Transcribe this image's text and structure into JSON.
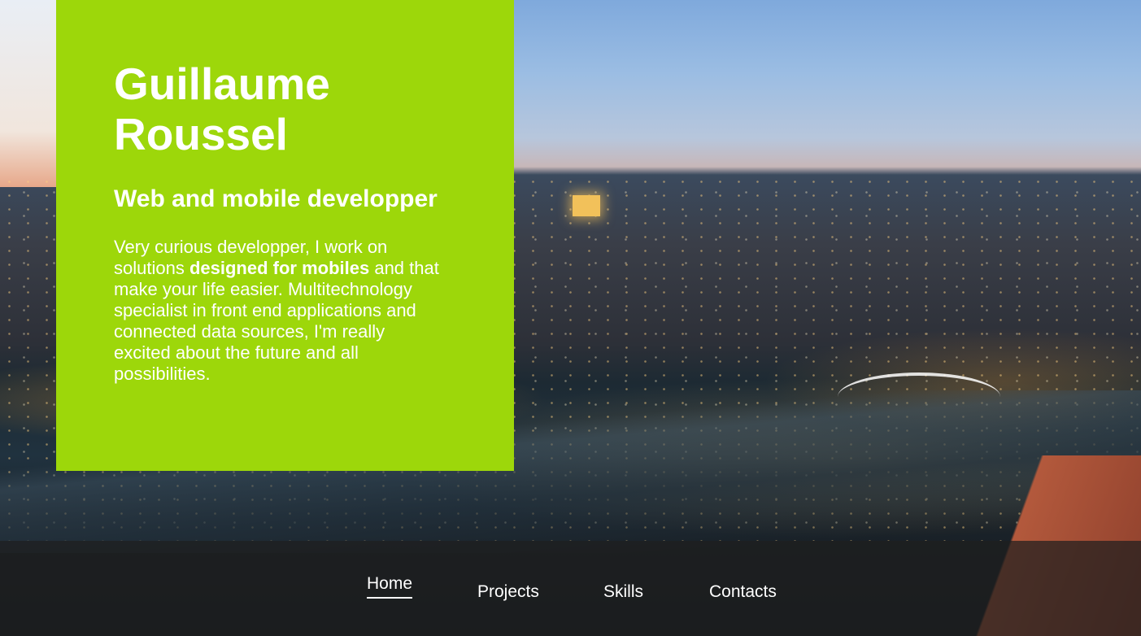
{
  "profile": {
    "name": "Guillaume Roussel",
    "headline": "Web and mobile developper",
    "bio_part1": "Very curious developper, I work on solutions ",
    "bio_emphasis": "designed for mobiles",
    "bio_part2": " and that make your life easier. Multitechnology specialist in front end applications and connected data sources, I'm really excited about the future and all possibilities."
  },
  "nav": {
    "items": [
      {
        "label": "Home",
        "active": true
      },
      {
        "label": "Projects",
        "active": false
      },
      {
        "label": "Skills",
        "active": false
      },
      {
        "label": "Contacts",
        "active": false
      }
    ]
  },
  "colors": {
    "accent": "#9dd70a",
    "nav_background": "#1e1e1e",
    "text": "#ffffff"
  }
}
